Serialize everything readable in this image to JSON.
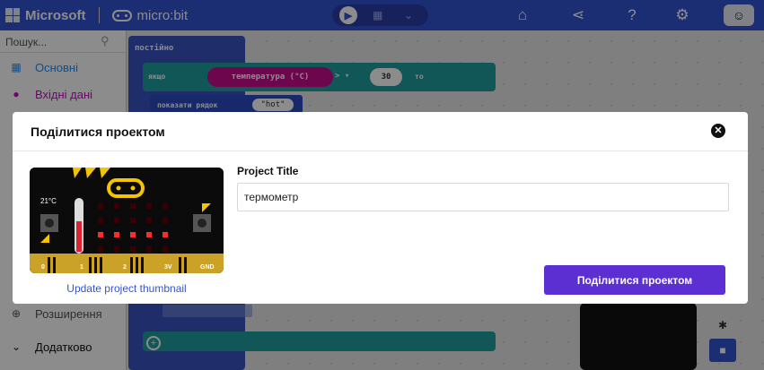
{
  "header": {
    "brand": "Microsoft",
    "product": "micro:bit",
    "icons": [
      "home-icon",
      "share-icon",
      "help-icon",
      "settings-icon",
      "profile-icon"
    ]
  },
  "toolbox": {
    "search_placeholder": "Пошук...",
    "categories": [
      {
        "label": "Основні",
        "color": "#1e90ff",
        "icon": "grid-icon"
      },
      {
        "label": "Вхідні дані",
        "color": "#d400d4",
        "icon": "circle-icon"
      },
      {
        "label": "Розширення",
        "color": "#555555",
        "icon": "plus-circle-icon"
      },
      {
        "label": "Додатково",
        "color": "#111111",
        "icon": "chevron-down-icon"
      }
    ]
  },
  "workspace": {
    "forever_label": "постійно",
    "if_label": "якщо",
    "temperature_label": "температура (°C)",
    "operator": "> ▾",
    "threshold": "30",
    "then_label": "то",
    "show_string_label": "показати рядок",
    "string_value": "\"hot\""
  },
  "modal": {
    "title": "Поділитися проектом",
    "thumbnail_temp": "21°C",
    "update_thumbnail_link": "Update project thumbnail",
    "project_title_label": "Project Title",
    "project_title_value": "термометр",
    "share_button": "Поділитися проектом",
    "pin_labels": [
      "0",
      "1",
      "2",
      "3V",
      "GND"
    ]
  },
  "colors": {
    "topbar": "#3454d1",
    "accent_button": "#5b2fd1",
    "link": "#3454d1"
  }
}
